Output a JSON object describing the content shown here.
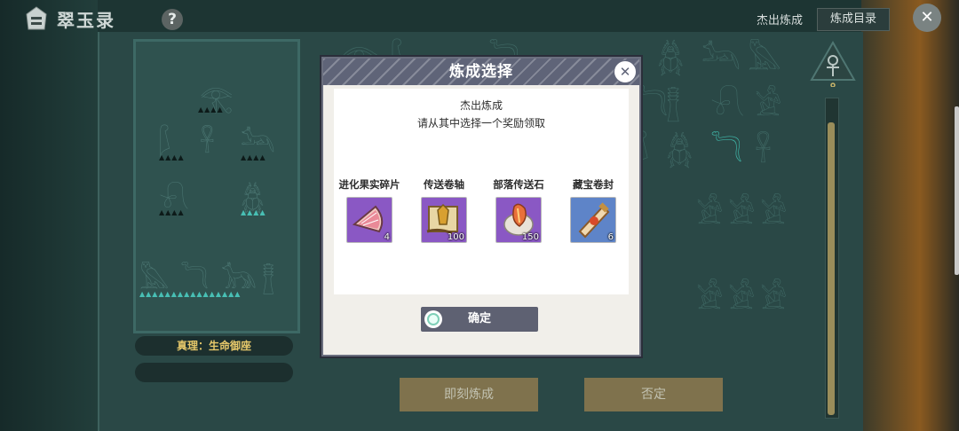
{
  "header": {
    "title": "翠玉录",
    "help_icon": "?",
    "close_icon": "✕"
  },
  "top_right": {
    "label": "杰出炼成",
    "catalog_button": "炼成目录"
  },
  "left_panel": {
    "truth_label": "真理：生命御座"
  },
  "bottom_buttons": {
    "craft_now": "即刻炼成",
    "deny": "否定"
  },
  "modal": {
    "title": "炼成选择",
    "close_icon": "✕",
    "subtitle": "杰出炼成",
    "instruction": "请从其中选择一个奖励领取",
    "rewards": [
      {
        "name": "进化果实碎片",
        "qty": "4",
        "icon": "fruit-fragment-icon",
        "bg": "#8a58c4"
      },
      {
        "name": "传送卷轴",
        "qty": "100",
        "icon": "teleport-scroll-icon",
        "bg": "#8a58c4"
      },
      {
        "name": "部落传送石",
        "qty": "150",
        "icon": "tribe-teleport-stone-icon",
        "bg": "#8a58c4"
      },
      {
        "name": "藏宝卷封",
        "qty": "6",
        "icon": "treasure-scroll-icon",
        "bg": "#5e84c8"
      }
    ],
    "confirm": "确定"
  },
  "colors": {
    "modal_header": "#5f6478",
    "truth_text": "#e6c86a",
    "bottom_button": "#9c8050"
  }
}
